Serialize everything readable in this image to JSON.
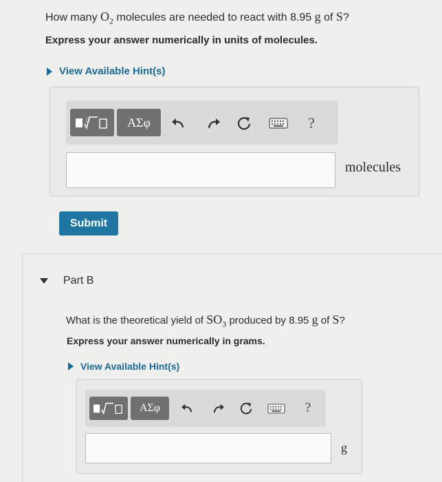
{
  "part_a": {
    "question_prefix": "How many",
    "question_species": "O",
    "question_species_sub": "2",
    "question_mid": "molecules are needed to react with",
    "question_mass": "8.95",
    "question_mass_unit": "g",
    "question_of": "of",
    "question_element": "S",
    "question_end": "?",
    "instruction": "Express your answer numerically in units of molecules.",
    "hint_label": "View Available Hint(s)",
    "toolbar": {
      "templates_icon": "templates-icon",
      "symbols_label": "ΑΣφ",
      "undo_icon": "undo-icon",
      "redo_icon": "redo-icon",
      "reset_icon": "reset-icon",
      "keyboard_icon": "keyboard-icon",
      "help_label": "?"
    },
    "answer_value": "",
    "unit_label": "molecules",
    "submit_label": "Submit"
  },
  "part_b": {
    "header": "Part B",
    "question_prefix": "What is the theoretical yield of",
    "question_species": "SO",
    "question_species_sub": "3",
    "question_mid": "produced by",
    "question_mass": "8.95",
    "question_mass_unit": "g",
    "question_of": "of",
    "question_element": "S",
    "question_end": "?",
    "instruction": "Express your answer numerically in grams.",
    "hint_label": "View Available Hint(s)",
    "toolbar": {
      "symbols_label": "ΑΣφ",
      "help_label": "?"
    },
    "answer_value": "",
    "unit_label": "g"
  },
  "colors": {
    "accent": "#1f76a3",
    "hint_link": "#1c6a9a",
    "background": "#efefed"
  }
}
